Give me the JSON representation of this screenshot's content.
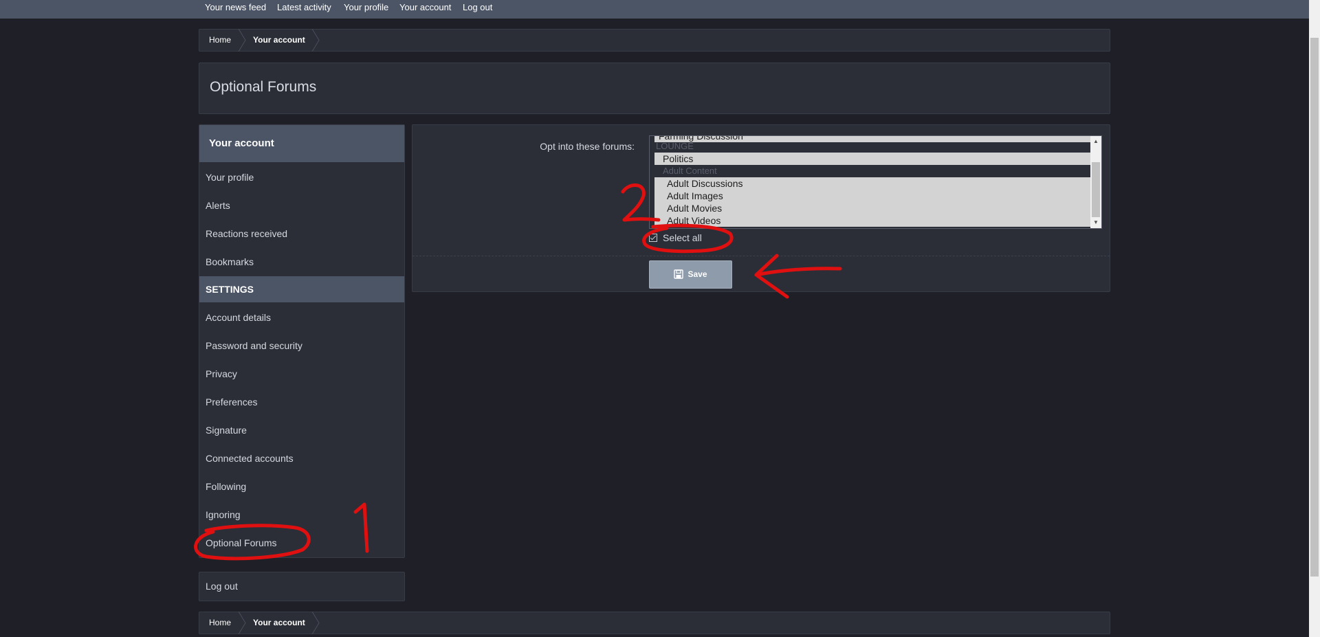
{
  "topnav": {
    "items": [
      "Your news feed",
      "Latest activity",
      "Your profile",
      "Your account",
      "Log out"
    ]
  },
  "breadcrumb": {
    "home": "Home",
    "current": "Your account"
  },
  "page": {
    "title": "Optional Forums"
  },
  "sidebar": {
    "heading": "Your account",
    "items": [
      "Your profile",
      "Alerts",
      "Reactions received",
      "Bookmarks"
    ],
    "section": "SETTINGS",
    "settings_items": [
      "Account details",
      "Password and security",
      "Privacy",
      "Preferences",
      "Signature",
      "Connected accounts",
      "Following",
      "Ignoring",
      "Optional Forums"
    ],
    "logout": "Log out"
  },
  "form": {
    "label": "Opt into these forums:",
    "options": [
      {
        "text": "Farming Discussion",
        "selected": true
      },
      {
        "text": "LOUNGE",
        "group": true
      },
      {
        "text": "Politics",
        "selected": true
      },
      {
        "text": "Adult Content",
        "group": true
      },
      {
        "text": "Adult Discussions",
        "selected": true
      },
      {
        "text": "Adult Images",
        "selected": true
      },
      {
        "text": "Adult Movies",
        "selected": true
      },
      {
        "text": "Adult Videos",
        "selected": true
      }
    ],
    "select_all": "Select all",
    "select_all_checked": true,
    "save_label": "Save"
  },
  "annotations": {
    "number_1": "1",
    "number_2": "2",
    "color": "#e01010"
  }
}
